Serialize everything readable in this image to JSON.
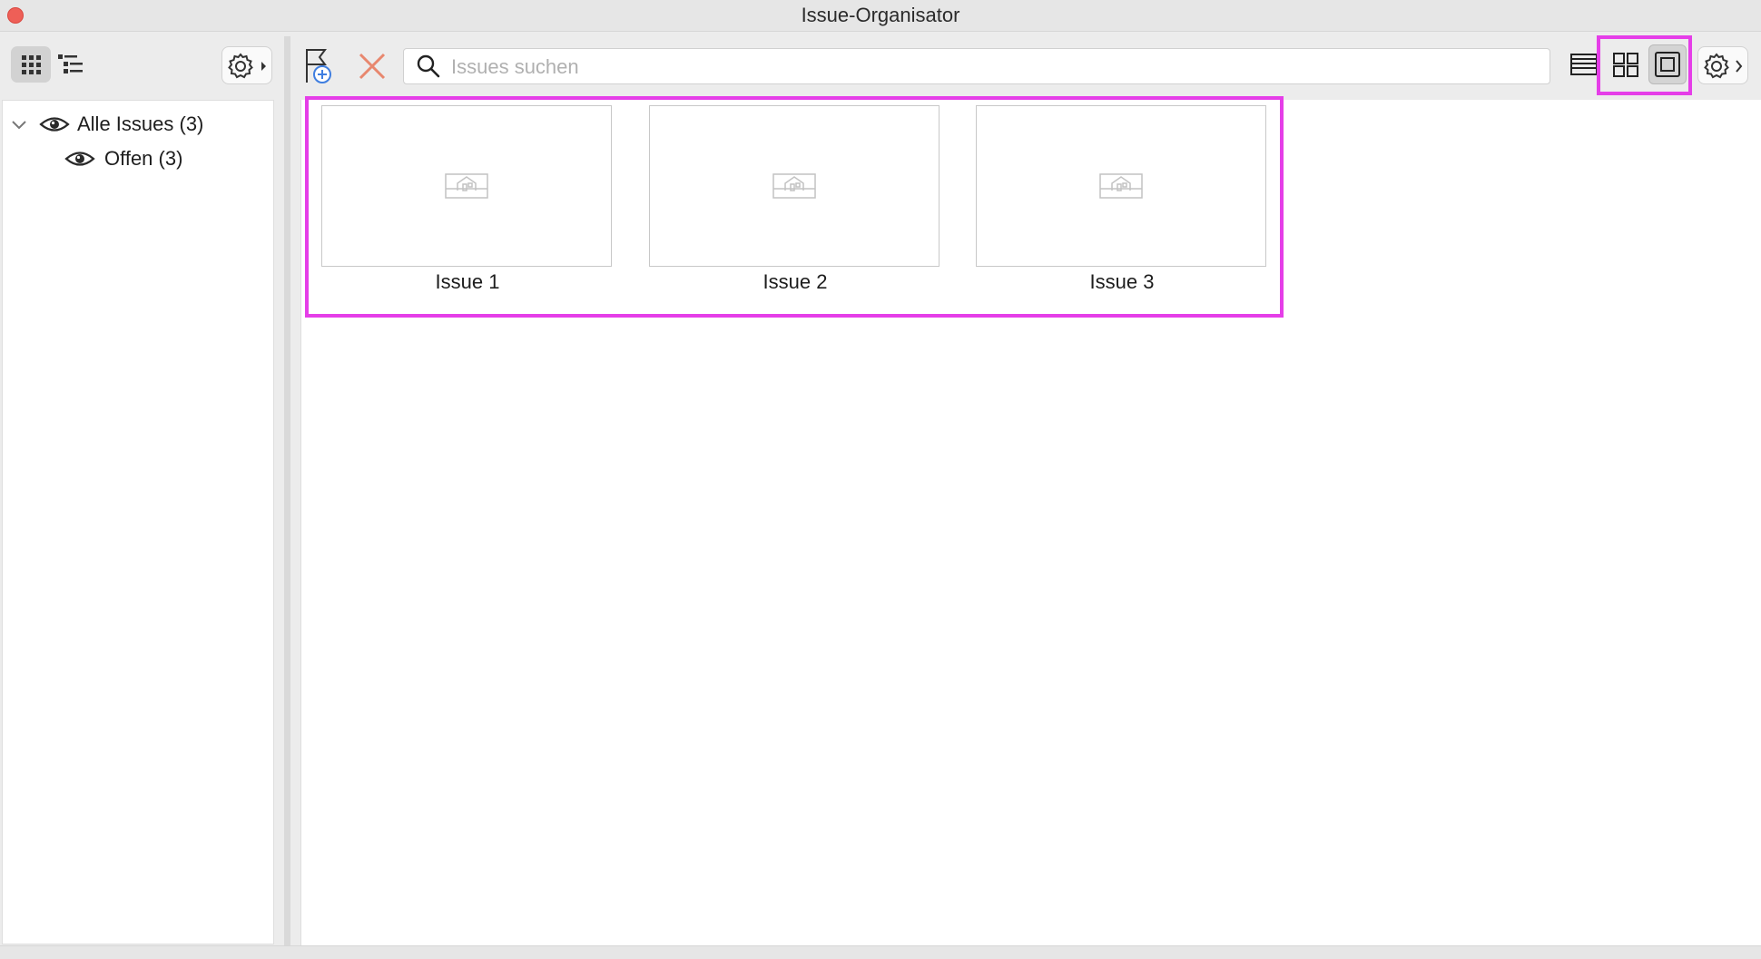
{
  "window": {
    "title": "Issue-Organisator"
  },
  "sidebar": {
    "tree": [
      {
        "label": "Alle Issues (3)",
        "expanded": true,
        "icon": "eye-icon"
      },
      {
        "label": "Offen (3)",
        "icon": "eye-icon"
      }
    ]
  },
  "toolbar": {
    "search_placeholder": "Issues suchen",
    "view_modes": [
      "list",
      "grid",
      "single"
    ],
    "active_view": "single"
  },
  "issues": [
    {
      "label": "Issue 1"
    },
    {
      "label": "Issue 2"
    },
    {
      "label": "Issue 3"
    }
  ],
  "colors": {
    "highlight": "#e53ee8",
    "delete": "#e8876e",
    "add_accent": "#3f7ee0"
  }
}
